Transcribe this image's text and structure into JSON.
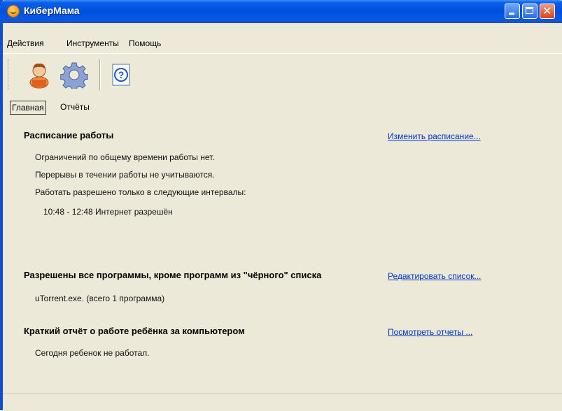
{
  "window": {
    "title": "КиберМама"
  },
  "menu": {
    "items": [
      "Действия",
      "Инструменты",
      "Помощь"
    ]
  },
  "toolbar": {
    "buttons": [
      "user-icon",
      "settings-gear-icon",
      "help-icon"
    ]
  },
  "tabs": [
    "Главная",
    "Отчёты"
  ],
  "schedule": {
    "title": "Расписание работы",
    "link": "Изменить расписание...",
    "lines": [
      "Ограничений по общему времени работы нет.",
      "Перерывы в течении работы не учитываются.",
      "Работать разрешено только в следующие интервалы:"
    ],
    "interval": "10:48 - 12:48 Интернет разрешён"
  },
  "programs": {
    "title": "Разрешены все программы, кроме программ из \"чёрного\" списка",
    "link": "Редактировать список...",
    "line": "uTorrent.exe. (всего 1 программа)"
  },
  "report": {
    "title": "Краткий отчёт о работе ребёнка за компьютером",
    "link": "Посмотреть отчеты ...",
    "line": "Сегодня ребенок не работал."
  },
  "colors": {
    "titlebar": "#0050e0",
    "link": "#0033cc",
    "background": "#ece9d8"
  }
}
